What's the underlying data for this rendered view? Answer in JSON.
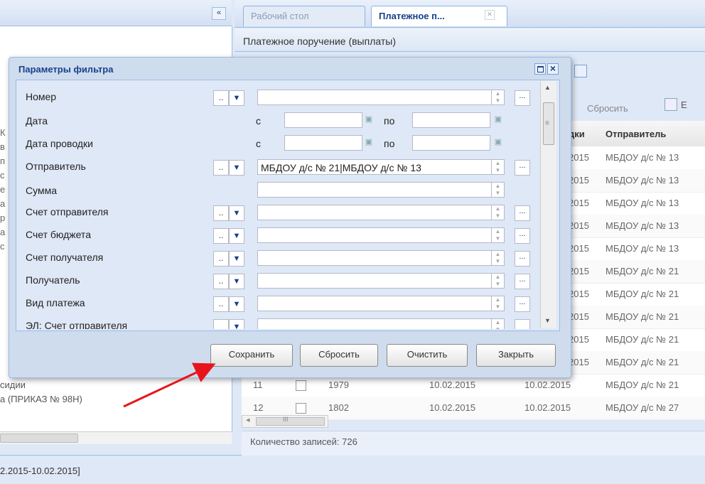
{
  "left_panel": {
    "collapse_label": "«",
    "trunc_letters": [
      "К",
      "в",
      "п",
      "с",
      "е",
      "а",
      "р",
      "а",
      "с"
    ],
    "item_text1": "сидии",
    "item_text2": "а (ПРИКАЗ № 98Н)",
    "footer_text": "2.2015-10.02.2015]"
  },
  "tabs": {
    "desktop": "Рабочий стол",
    "payment": "Платежное п...",
    "close": "✕"
  },
  "panel": {
    "title": "Платежное поручение (выплаты)"
  },
  "toolbar": {
    "reset": "Сбросить",
    "e_label": "Е"
  },
  "grid": {
    "col_date": "дки",
    "col_sender": "Отправитель",
    "rows": [
      {
        "date": "2015",
        "sender": "МБДОУ д/с № 13"
      },
      {
        "date": "2015",
        "sender": "МБДОУ д/с № 13"
      },
      {
        "date": "2015",
        "sender": "МБДОУ д/с № 13"
      },
      {
        "date": "2015",
        "sender": "МБДОУ д/с № 13"
      },
      {
        "date": "2015",
        "sender": "МБДОУ д/с № 13"
      },
      {
        "date": "2015",
        "sender": "МБДОУ д/с № 21"
      },
      {
        "date": "2015",
        "sender": "МБДОУ д/с № 21"
      },
      {
        "date": "2015",
        "sender": "МБДОУ д/с № 21"
      },
      {
        "date": "2015",
        "sender": "МБДОУ д/с № 21"
      },
      {
        "date": "2015",
        "sender": "МБДОУ д/с № 21"
      }
    ],
    "full_rows": [
      {
        "num": "11",
        "id": "1979",
        "date": "10.02.2015",
        "pdate": "10.02.2015",
        "sender": "МБДОУ д/с № 21"
      },
      {
        "num": "12",
        "id": "1802",
        "date": "10.02.2015",
        "pdate": "10.02.2015",
        "sender": "МБДОУ д/с № 27"
      }
    ],
    "scroll_arrow": "◂",
    "scroll_grip": "III",
    "record_count": "Количество записей: 726"
  },
  "dialog": {
    "title": "Параметры фильтра",
    "fields": [
      {
        "label": "Номер",
        "value": ""
      },
      {
        "label": "Отправитель",
        "value": "МБДОУ д/с № 21|МБДОУ д/с № 13"
      },
      {
        "label": "Сумма",
        "value": ""
      },
      {
        "label": "Счет отправителя",
        "value": ""
      },
      {
        "label": "Счет бюджета",
        "value": ""
      },
      {
        "label": "Счет получателя",
        "value": ""
      },
      {
        "label": "Получатель",
        "value": ""
      },
      {
        "label": "Вид платежа",
        "value": ""
      },
      {
        "label": "ЭЛ: Счет отправителя",
        "value": ""
      }
    ],
    "date_fields": [
      {
        "label": "Дата",
        "from": "с",
        "to": "по"
      },
      {
        "label": "Дата проводки",
        "from": "с",
        "to": "по"
      }
    ],
    "operator_label": "..",
    "ellipsis_label": "...",
    "buttons": {
      "save": "Сохранить",
      "reset": "Сбросить",
      "clear": "Очистить",
      "close": "Закрыть"
    }
  },
  "colors": {
    "accent": "#15428b",
    "arrow": "#e8141b"
  },
  "icons": {
    "dropdown": "chevron-down-icon",
    "calendar": "calendar-icon",
    "spinner": "spinner-icon",
    "close": "close-icon",
    "maximize": "maximize-icon"
  }
}
